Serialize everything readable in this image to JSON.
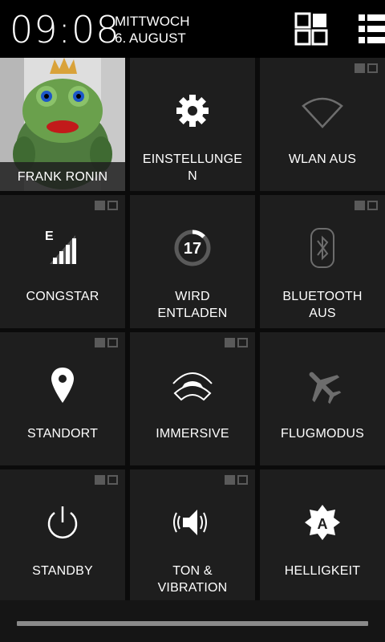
{
  "header": {
    "time": "09:08",
    "weekday": "MITTWOCH",
    "date": "6. AUGUST",
    "grid_icon": "quick-settings-grid-icon",
    "list_icon": "notifications-list-icon"
  },
  "tiles": [
    {
      "label": "FRANK RONIN",
      "icon": "user-avatar"
    },
    {
      "label": "EINSTELLUNGE\nN",
      "icon": "gear-icon"
    },
    {
      "label": "WLAN AUS",
      "icon": "wifi-icon"
    },
    {
      "label": "CONGSTAR",
      "icon": "signal-icon",
      "badge": "E"
    },
    {
      "label": "WIRD\nENTLADEN",
      "icon": "battery-icon",
      "value": "17"
    },
    {
      "label": "BLUETOOTH\nAUS",
      "icon": "bluetooth-icon"
    },
    {
      "label": "STANDORT",
      "icon": "location-icon"
    },
    {
      "label": "IMMERSIVE",
      "icon": "immersive-icon"
    },
    {
      "label": "FLUGMODUS",
      "icon": "airplane-icon"
    },
    {
      "label": "STANDBY",
      "icon": "power-icon"
    },
    {
      "label": "TON &\nVIBRATION",
      "icon": "sound-icon"
    },
    {
      "label": "HELLIGKEIT",
      "icon": "brightness-icon"
    }
  ],
  "colors": {
    "tile_bg": "#1e1e1e",
    "background": "#0b0b0b",
    "indicator": "#5a5a5a"
  }
}
